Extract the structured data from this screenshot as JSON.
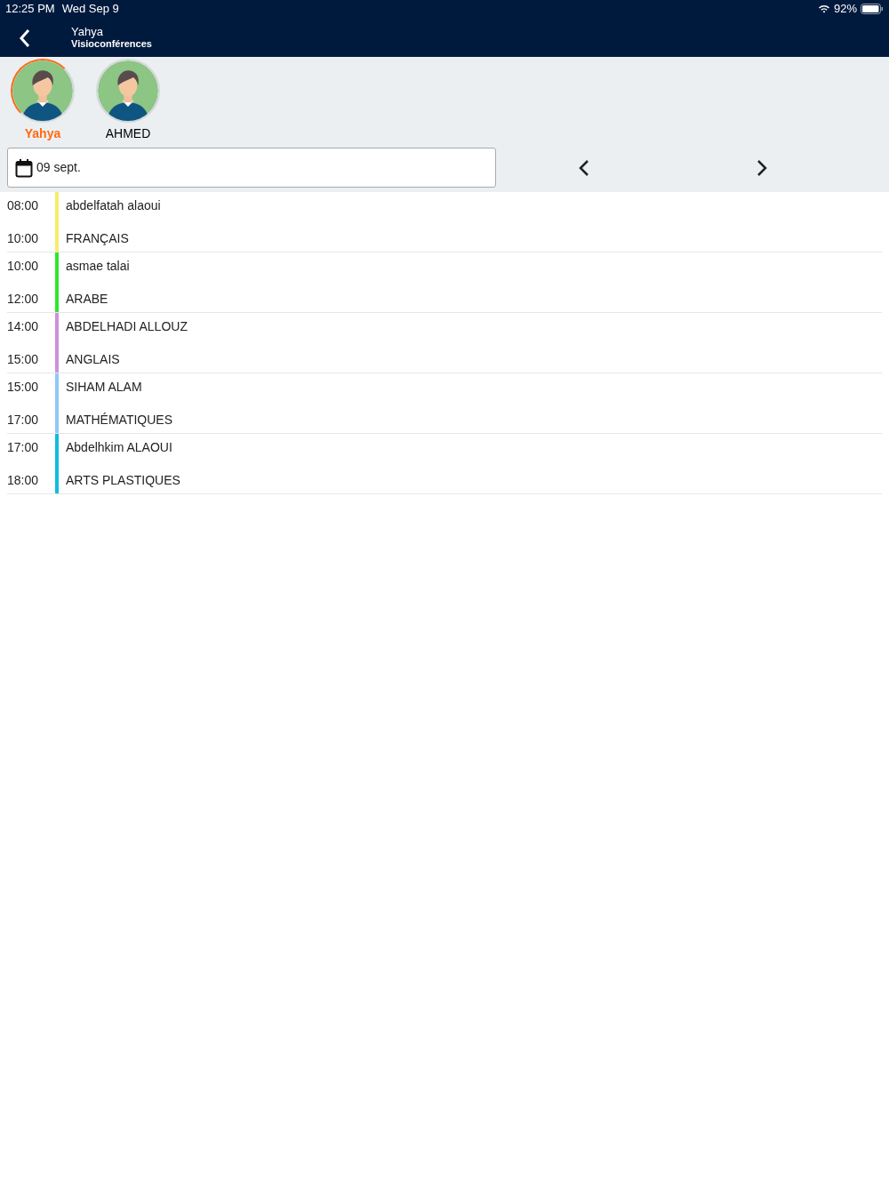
{
  "status_bar": {
    "time": "12:25 PM",
    "date": "Wed Sep 9",
    "battery": "92%"
  },
  "header": {
    "title": "Yahya",
    "subtitle": "Visioconférences"
  },
  "profiles": [
    {
      "name": "Yahya",
      "selected": true
    },
    {
      "name": "AHMED",
      "selected": false
    }
  ],
  "date_field": {
    "value": "09 sept."
  },
  "events": [
    {
      "start": "08:00",
      "end": "10:00",
      "teacher": "abdelfatah alaoui",
      "subject": "FRANÇAIS",
      "color": "#f7ec6e"
    },
    {
      "start": "10:00",
      "end": "12:00",
      "teacher": "asmae talai",
      "subject": "ARABE",
      "color": "#2ee82e"
    },
    {
      "start": "14:00",
      "end": "15:00",
      "teacher": "ABDELHADI ALLOUZ",
      "subject": "ANGLAIS",
      "color": "#cf8fdc"
    },
    {
      "start": "15:00",
      "end": "17:00",
      "teacher": "SIHAM ALAM",
      "subject": "MATHÉMATIQUES",
      "color": "#8fc9f5"
    },
    {
      "start": "17:00",
      "end": "18:00",
      "teacher": "Abdelhkim ALAOUI",
      "subject": "ARTS PLASTIQUES",
      "color": "#10bde0"
    }
  ]
}
